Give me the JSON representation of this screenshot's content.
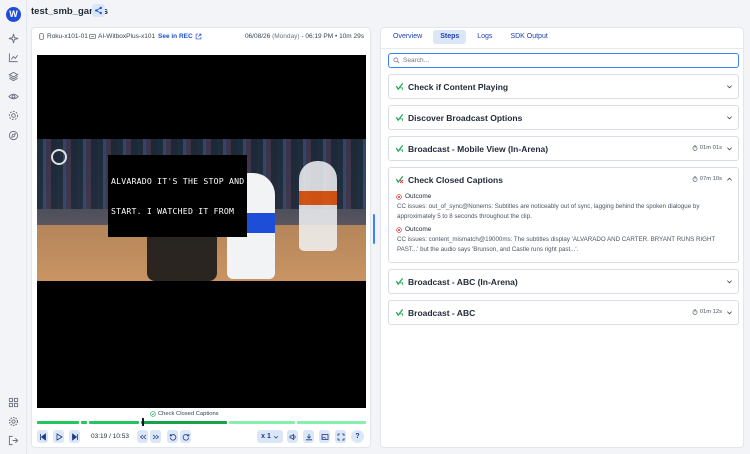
{
  "app": {
    "logo_letter": "W",
    "title": "test_smb_games"
  },
  "device_bar": {
    "device": "Roku-x101-01",
    "witbox": "AI-WitboxPlus-x101",
    "rec_link": "See in REC",
    "date": "06/08/26",
    "weekday": "(Monday)",
    "separator": "-",
    "time": "06:19 PM",
    "separator2": "•",
    "duration": "10m 29s"
  },
  "video": {
    "caption_line1": "ALVARADO IT'S THE STOP AND",
    "caption_line2": "START. I WATCHED IT FROM"
  },
  "timeline": {
    "current_segment_label": "Check Closed Captions",
    "segments_color": "#22c55e",
    "active_color": "#16a34a",
    "progress_fraction": 0.3
  },
  "controls": {
    "time_readout": "03:19 / 10:53",
    "speed": "x 1",
    "help": "?"
  },
  "tabs": [
    {
      "label": "Overview"
    },
    {
      "label": "Steps"
    },
    {
      "label": "Logs"
    },
    {
      "label": "SDK Output"
    }
  ],
  "search": {
    "placeholder": "Search..."
  },
  "steps": [
    {
      "title": "Check if Content Playing",
      "duration": "",
      "status": "pass"
    },
    {
      "title": "Discover Broadcast Options",
      "duration": "",
      "status": "pass"
    },
    {
      "title": "Broadcast - Mobile View (In-Arena)",
      "duration": "01m 01s",
      "status": "pass"
    },
    {
      "title": "Check Closed Captions",
      "duration": "07m 10s",
      "status": "fail",
      "outcomes": [
        {
          "label": "Outcome",
          "text": "CC issues: out_of_sync@Nonems: Subtitles are noticeably out of sync, lagging behind the spoken dialogue by approximately 5 to 8 seconds throughout the clip."
        },
        {
          "label": "Outcome",
          "text": "CC issues: content_mismatch@19000ms: The subtitles display 'ALVARADO AND CARTER. BRYANT RUNS RIGHT PAST...' but the audio says 'Brunson, and Castle runs right past...'."
        }
      ]
    },
    {
      "title": "Broadcast - ABC (In-Arena)",
      "duration": "",
      "status": "pass"
    },
    {
      "title": "Broadcast - ABC",
      "duration": "01m 12s",
      "status": "pass"
    }
  ],
  "colors": {
    "accent": "#1d4ed8",
    "pass": "#16a34a",
    "fail": "#dc2626"
  }
}
